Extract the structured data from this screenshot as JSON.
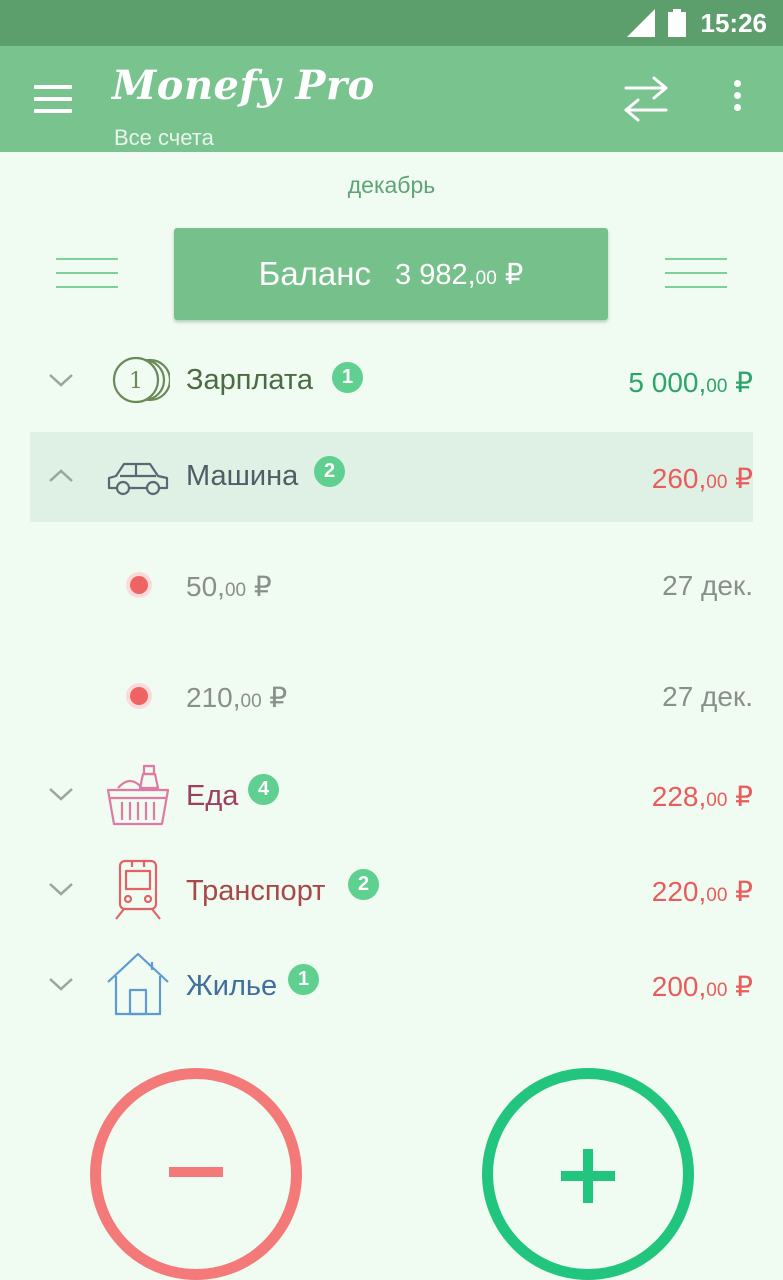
{
  "status": {
    "time": "15:26"
  },
  "app": {
    "title": "Monefy Pro",
    "subtitle": "Все счета"
  },
  "period": {
    "label": "декабрь"
  },
  "balance": {
    "label": "Баланс",
    "value_int": "3 982,",
    "value_dec": "00",
    "currency": "₽"
  },
  "categories": [
    {
      "name": "Зарплата",
      "count": "1",
      "amount_int": "5 000,",
      "amount_dec": "00",
      "currency": "₽",
      "color": "#2ea36a",
      "name_color": "#4c6a44",
      "icon": "coins-icon",
      "expanded": false
    },
    {
      "name": "Машина",
      "count": "2",
      "amount_int": "260,",
      "amount_dec": "00",
      "currency": "₽",
      "color": "#ea5c5c",
      "name_color": "#505c66",
      "icon": "car-icon",
      "expanded": true,
      "entries": [
        {
          "amount_int": "50,",
          "amount_dec": "00",
          "currency": "₽",
          "date": "27 дек."
        },
        {
          "amount_int": "210,",
          "amount_dec": "00",
          "currency": "₽",
          "date": "27 дек."
        }
      ]
    },
    {
      "name": "Еда",
      "count": "4",
      "amount_int": "228,",
      "amount_dec": "00",
      "currency": "₽",
      "color": "#ea5c5c",
      "name_color": "#9c4060",
      "icon": "food-basket-icon",
      "expanded": false
    },
    {
      "name": "Транспорт",
      "count": "2",
      "amount_int": "220,",
      "amount_dec": "00",
      "currency": "₽",
      "color": "#ea5c5c",
      "name_color": "#a84848",
      "icon": "train-icon",
      "expanded": false
    },
    {
      "name": "Жилье",
      "count": "1",
      "amount_int": "200,",
      "amount_dec": "00",
      "currency": "₽",
      "color": "#ea5c5c",
      "name_color": "#3f6f9a",
      "icon": "house-icon",
      "expanded": false
    }
  ],
  "colors": {
    "statusbar": "#5d9f6c",
    "appbar": "#79c38f",
    "background": "#f0fbf2",
    "expense_fab": "#f47a7a",
    "income_fab": "#22c57e"
  }
}
